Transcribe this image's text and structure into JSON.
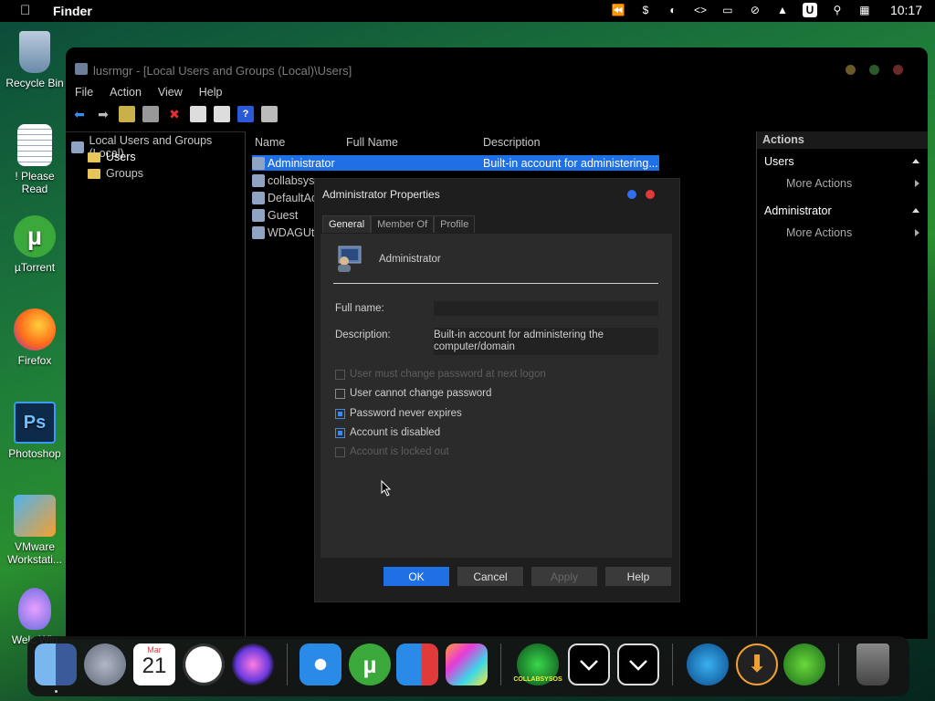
{
  "menubar": {
    "app_name": "Finder",
    "time": "10:17"
  },
  "desktop_icons": [
    {
      "label": "Recycle Bin"
    },
    {
      "label": "! Please Read"
    },
    {
      "label": "µTorrent"
    },
    {
      "label": "Firefox"
    },
    {
      "label": "Photoshop"
    },
    {
      "label": "VMware Workstati..."
    },
    {
      "label": "Welc Win"
    }
  ],
  "window": {
    "title": "lusrmgr - [Local Users and Groups (Local)\\Users]",
    "menu": [
      "File",
      "Action",
      "View",
      "Help"
    ],
    "tree": {
      "root": "Local Users and Groups (Local)",
      "items": [
        "Users",
        "Groups"
      ]
    },
    "columns": [
      "Name",
      "Full Name",
      "Description"
    ],
    "users": [
      {
        "name": "Administrator",
        "description": "Built-in account for administering..."
      },
      {
        "name": "collabsysos",
        "description": ""
      },
      {
        "name": "DefaultAc",
        "description": ""
      },
      {
        "name": "Guest",
        "description": ""
      },
      {
        "name": "WDAGUti",
        "description": ""
      }
    ],
    "actions": {
      "header": "Actions",
      "section1": "Users",
      "more1": "More Actions",
      "section2": "Administrator",
      "more2": "More Actions"
    }
  },
  "dialog": {
    "title": "Administrator Properties",
    "tabs": [
      "General",
      "Member Of",
      "Profile"
    ],
    "username": "Administrator",
    "full_name_label": "Full name:",
    "full_name_value": "",
    "description_label": "Description:",
    "description_value": "Built-in account for administering the computer/domain",
    "checkboxes": [
      {
        "label": "User must change password at next logon",
        "checked": false,
        "disabled": true
      },
      {
        "label": "User cannot change password",
        "checked": false,
        "disabled": false
      },
      {
        "label": "Password never expires",
        "checked": true,
        "disabled": false
      },
      {
        "label": "Account is disabled",
        "checked": true,
        "disabled": false
      },
      {
        "label": "Account is locked out",
        "checked": false,
        "disabled": true
      }
    ],
    "buttons": {
      "ok": "OK",
      "cancel": "Cancel",
      "apply": "Apply",
      "help": "Help"
    }
  },
  "dock": {
    "calendar_month": "Mar",
    "calendar_day": "21",
    "collabsysos_label": "COLLABSYSOS"
  },
  "colors": {
    "accent": "#1f6fe5",
    "window_bg": "#000000",
    "dialog_bg": "#1e1e1e",
    "panel_bg": "#2b2b2b"
  }
}
